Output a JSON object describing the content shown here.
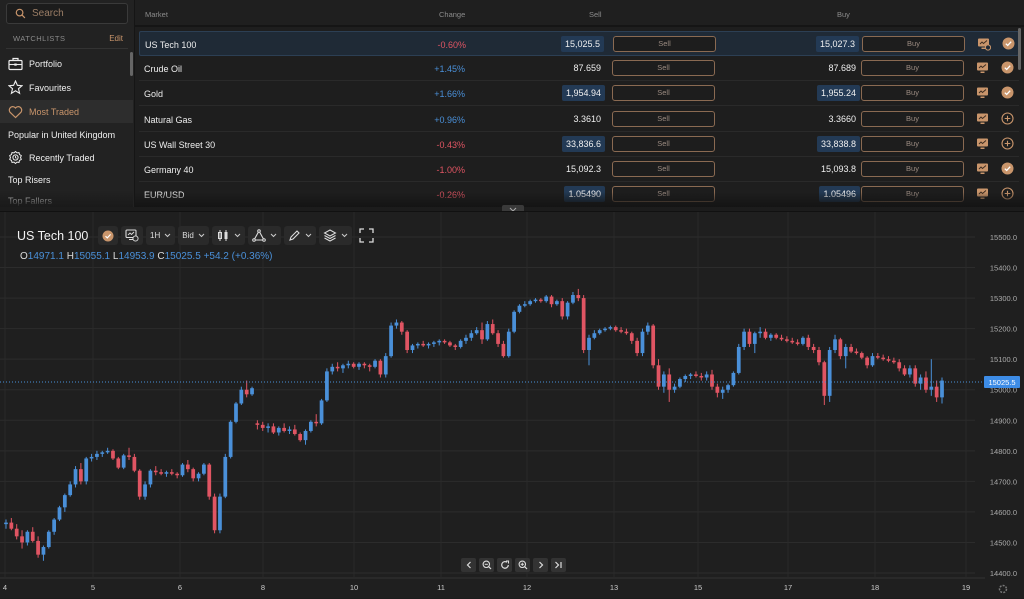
{
  "sidebar": {
    "search_placeholder": "Search",
    "watchlists_label": "WATCHLISTS",
    "edit_label": "Edit",
    "items": [
      {
        "label": "Portfolio",
        "icon": "briefcase-icon",
        "active": false
      },
      {
        "label": "Favourites",
        "icon": "star-icon",
        "active": false
      },
      {
        "label": "Most Traded",
        "icon": "heart-icon",
        "active": true
      },
      {
        "label": "Popular in United Kingdom",
        "icon": null,
        "active": false
      },
      {
        "label": "Recently Traded",
        "icon": "recent-icon",
        "active": false
      },
      {
        "label": "Top Risers",
        "icon": null,
        "active": false
      },
      {
        "label": "Top Fallers",
        "icon": null,
        "active": false
      }
    ]
  },
  "table": {
    "headers": {
      "market": "Market",
      "change": "Change",
      "sell": "Sell",
      "buy": "Buy"
    },
    "sell_label": "Sell",
    "buy_label": "Buy",
    "rows": [
      {
        "market": "US Tech 100",
        "change": "-0.60%",
        "direction": "neg",
        "sell": "15,025.5",
        "buy": "15,027.3",
        "highlight": true,
        "selected": true,
        "in_watchlist": true,
        "chart_open": true
      },
      {
        "market": "Crude Oil",
        "change": "+1.45%",
        "direction": "pos",
        "sell": "87.659",
        "buy": "87.689",
        "highlight": false,
        "selected": false,
        "in_watchlist": true,
        "chart_open": false
      },
      {
        "market": "Gold",
        "change": "+1.66%",
        "direction": "pos",
        "sell": "1,954.94",
        "buy": "1,955.24",
        "highlight": true,
        "selected": false,
        "in_watchlist": true,
        "chart_open": false
      },
      {
        "market": "Natural Gas",
        "change": "+0.96%",
        "direction": "pos",
        "sell": "3.3610",
        "buy": "3.3660",
        "highlight": false,
        "selected": false,
        "in_watchlist": false,
        "chart_open": false
      },
      {
        "market": "US Wall Street 30",
        "change": "-0.43%",
        "direction": "neg",
        "sell": "33,836.6",
        "buy": "33,838.8",
        "highlight": true,
        "selected": false,
        "in_watchlist": false,
        "chart_open": false
      },
      {
        "market": "Germany 40",
        "change": "-1.00%",
        "direction": "neg",
        "sell": "15,092.3",
        "buy": "15,093.8",
        "highlight": false,
        "selected": false,
        "in_watchlist": true,
        "chart_open": false
      },
      {
        "market": "EUR/USD",
        "change": "-0.26%",
        "direction": "neg",
        "sell": "1.05490",
        "buy": "1.05496",
        "highlight": true,
        "selected": false,
        "in_watchlist": false,
        "chart_open": false
      }
    ]
  },
  "chart_panel": {
    "title": "US Tech 100",
    "timeframe": "1H",
    "price_side": "Bid",
    "ohlc": {
      "o_label": "O",
      "o": "14971.1",
      "h_label": "H",
      "h": "15055.1",
      "l_label": "L",
      "l": "14953.9",
      "c_label": "C",
      "c": "15025.5",
      "change": "+54.2 (+0.36%)"
    },
    "current_price_label": "15025.5"
  },
  "colors": {
    "up": "#4a90d9",
    "down": "#e05563",
    "accent": "#c9956b",
    "highlight_price": "#233a55"
  },
  "chart_data": {
    "type": "candlestick",
    "title": "US Tech 100",
    "xlabel": "",
    "ylabel": "",
    "ylim": [
      14400,
      15500
    ],
    "y_ticks": [
      "15500.0",
      "15400.0",
      "15300.0",
      "15200.0",
      "15100.0",
      "15000.0",
      "14900.0",
      "14800.0",
      "14700.0",
      "14600.0",
      "14500.0",
      "14400.0"
    ],
    "x_ticks": [
      "4",
      "5",
      "6",
      "8",
      "10",
      "11",
      "12",
      "13",
      "15",
      "17",
      "18",
      "19"
    ],
    "current_price": 15025.5,
    "grid": true,
    "candles": [
      [
        14560,
        14575,
        14545,
        14565
      ],
      [
        14565,
        14580,
        14540,
        14545
      ],
      [
        14545,
        14560,
        14510,
        14520
      ],
      [
        14520,
        14540,
        14480,
        14500
      ],
      [
        14500,
        14540,
        14490,
        14535
      ],
      [
        14535,
        14550,
        14500,
        14505
      ],
      [
        14505,
        14520,
        14450,
        14460
      ],
      [
        14460,
        14490,
        14440,
        14485
      ],
      [
        14485,
        14540,
        14480,
        14535
      ],
      [
        14535,
        14580,
        14525,
        14575
      ],
      [
        14575,
        14620,
        14570,
        14615
      ],
      [
        14615,
        14660,
        14600,
        14655
      ],
      [
        14655,
        14700,
        14650,
        14690
      ],
      [
        14690,
        14750,
        14680,
        14740
      ],
      [
        14740,
        14760,
        14690,
        14700
      ],
      [
        14700,
        14780,
        14690,
        14775
      ],
      [
        14775,
        14790,
        14765,
        14780
      ],
      [
        14780,
        14800,
        14770,
        14790
      ],
      [
        14790,
        14800,
        14780,
        14795
      ],
      [
        14795,
        14810,
        14790,
        14800
      ],
      [
        14800,
        14805,
        14770,
        14775
      ],
      [
        14775,
        14780,
        14740,
        14745
      ],
      [
        14745,
        14790,
        14740,
        14785
      ],
      [
        14785,
        14810,
        14770,
        14780
      ],
      [
        14780,
        14790,
        14730,
        14735
      ],
      [
        14735,
        14740,
        14640,
        14650
      ],
      [
        14650,
        14700,
        14640,
        14690
      ],
      [
        14690,
        14740,
        14680,
        14735
      ],
      [
        14735,
        14750,
        14720,
        14730
      ],
      [
        14730,
        14740,
        14720,
        14725
      ],
      [
        14725,
        14735,
        14715,
        14730
      ],
      [
        14730,
        14740,
        14720,
        14725
      ],
      [
        14725,
        14730,
        14710,
        14720
      ],
      [
        14720,
        14760,
        14715,
        14755
      ],
      [
        14755,
        14770,
        14730,
        14740
      ],
      [
        14740,
        14745,
        14700,
        14710
      ],
      [
        14710,
        14730,
        14700,
        14725
      ],
      [
        14725,
        14760,
        14720,
        14755
      ],
      [
        14755,
        14760,
        14640,
        14650
      ],
      [
        14650,
        14660,
        14530,
        14540
      ],
      [
        14540,
        14660,
        14530,
        14650
      ],
      [
        14650,
        14790,
        14645,
        14780
      ],
      [
        14780,
        14900,
        14775,
        14895
      ],
      [
        14895,
        14960,
        14890,
        14955
      ],
      [
        14955,
        15010,
        14950,
        15000
      ],
      [
        15000,
        15030,
        14975,
        14985
      ],
      [
        14985,
        15010,
        14980,
        15005
      ],
      [
        14890,
        14900,
        14870,
        14885
      ],
      [
        14885,
        14895,
        14865,
        14875
      ],
      [
        14875,
        14890,
        14860,
        14880
      ],
      [
        14880,
        14890,
        14855,
        14860
      ],
      [
        14860,
        14880,
        14850,
        14875
      ],
      [
        14875,
        14890,
        14860,
        14865
      ],
      [
        14865,
        14880,
        14855,
        14870
      ],
      [
        14870,
        14885,
        14850,
        14855
      ],
      [
        14855,
        14860,
        14830,
        14835
      ],
      [
        14835,
        14870,
        14820,
        14865
      ],
      [
        14865,
        14900,
        14860,
        14895
      ],
      [
        14895,
        14920,
        14880,
        14890
      ],
      [
        14890,
        14970,
        14885,
        14965
      ],
      [
        14965,
        15070,
        14960,
        15060
      ],
      [
        15060,
        15085,
        15050,
        15075
      ],
      [
        15075,
        15090,
        15060,
        15070
      ],
      [
        15070,
        15085,
        15055,
        15080
      ],
      [
        15080,
        15095,
        15070,
        15085
      ],
      [
        15085,
        15090,
        15070,
        15075
      ],
      [
        15075,
        15090,
        15065,
        15085
      ],
      [
        15085,
        15090,
        15070,
        15080
      ],
      [
        15080,
        15085,
        15060,
        15075
      ],
      [
        15075,
        15100,
        15070,
        15095
      ],
      [
        15095,
        15100,
        15040,
        15050
      ],
      [
        15050,
        15120,
        15040,
        15110
      ],
      [
        15110,
        15220,
        15105,
        15210
      ],
      [
        15210,
        15230,
        15200,
        15220
      ],
      [
        15220,
        15225,
        15180,
        15190
      ],
      [
        15190,
        15195,
        15120,
        15130
      ],
      [
        15130,
        15150,
        15120,
        15145
      ],
      [
        15145,
        15155,
        15135,
        15150
      ],
      [
        15150,
        15160,
        15140,
        15145
      ],
      [
        15145,
        15155,
        15135,
        15150
      ],
      [
        15150,
        15160,
        15140,
        15155
      ],
      [
        15155,
        15165,
        15145,
        15160
      ],
      [
        15160,
        15165,
        15150,
        15155
      ],
      [
        15155,
        15160,
        15140,
        15145
      ],
      [
        15145,
        15150,
        15130,
        15140
      ],
      [
        15140,
        15165,
        15135,
        15160
      ],
      [
        15160,
        15180,
        15150,
        15170
      ],
      [
        15170,
        15195,
        15160,
        15185
      ],
      [
        15185,
        15205,
        15180,
        15195
      ],
      [
        15195,
        15220,
        15150,
        15165
      ],
      [
        15165,
        15225,
        15160,
        15215
      ],
      [
        15215,
        15230,
        15180,
        15185
      ],
      [
        15185,
        15195,
        15140,
        15150
      ],
      [
        15150,
        15160,
        15105,
        15110
      ],
      [
        15110,
        15200,
        15105,
        15190
      ],
      [
        15190,
        15260,
        15185,
        15255
      ],
      [
        15255,
        15280,
        15250,
        15275
      ],
      [
        15275,
        15290,
        15270,
        15280
      ],
      [
        15280,
        15295,
        15275,
        15290
      ],
      [
        15290,
        15300,
        15285,
        15295
      ],
      [
        15295,
        15300,
        15285,
        15290
      ],
      [
        15290,
        15310,
        15285,
        15305
      ],
      [
        15305,
        15310,
        15270,
        15280
      ],
      [
        15280,
        15295,
        15275,
        15290
      ],
      [
        15290,
        15300,
        15230,
        15240
      ],
      [
        15240,
        15290,
        15230,
        15285
      ],
      [
        15285,
        15320,
        15280,
        15310
      ],
      [
        15310,
        15330,
        15290,
        15300
      ],
      [
        15300,
        15310,
        15120,
        15130
      ],
      [
        15130,
        15180,
        15080,
        15170
      ],
      [
        15170,
        15195,
        15165,
        15185
      ],
      [
        15185,
        15200,
        15180,
        15195
      ],
      [
        15195,
        15205,
        15190,
        15200
      ],
      [
        15200,
        15210,
        15195,
        15205
      ],
      [
        15205,
        15210,
        15190,
        15195
      ],
      [
        15195,
        15205,
        15185,
        15190
      ],
      [
        15190,
        15200,
        15180,
        15185
      ],
      [
        15185,
        15190,
        15150,
        15160
      ],
      [
        15160,
        15170,
        15110,
        15120
      ],
      [
        15120,
        15200,
        15110,
        15190
      ],
      [
        15190,
        15220,
        15180,
        15210
      ],
      [
        15210,
        15215,
        15070,
        15080
      ],
      [
        15080,
        15100,
        15000,
        15010
      ],
      [
        15010,
        15060,
        14990,
        15050
      ],
      [
        15050,
        15070,
        14960,
        15000
      ],
      [
        15000,
        15020,
        14990,
        15010
      ],
      [
        15010,
        15040,
        15005,
        15035
      ],
      [
        15035,
        15050,
        15025,
        15045
      ],
      [
        15045,
        15055,
        15035,
        15050
      ],
      [
        15050,
        15060,
        15040,
        15045
      ],
      [
        15045,
        15055,
        15030,
        15040
      ],
      [
        15040,
        15060,
        15030,
        15050
      ],
      [
        15050,
        15065,
        15000,
        15010
      ],
      [
        15010,
        15020,
        14975,
        14990
      ],
      [
        14990,
        15010,
        14970,
        15000
      ],
      [
        15000,
        15020,
        14990,
        15015
      ],
      [
        15015,
        15060,
        15010,
        15055
      ],
      [
        15055,
        15150,
        15050,
        15140
      ],
      [
        15140,
        15200,
        15130,
        15190
      ],
      [
        15190,
        15200,
        15140,
        15150
      ],
      [
        15150,
        15190,
        15120,
        15185
      ],
      [
        15185,
        15205,
        15170,
        15190
      ],
      [
        15190,
        15200,
        15165,
        15170
      ],
      [
        15170,
        15185,
        15160,
        15180
      ],
      [
        15180,
        15185,
        15165,
        15170
      ],
      [
        15170,
        15180,
        15160,
        15165
      ],
      [
        15165,
        15175,
        15155,
        15160
      ],
      [
        15160,
        15170,
        15150,
        15155
      ],
      [
        15155,
        15165,
        15145,
        15150
      ],
      [
        15150,
        15175,
        15145,
        15170
      ],
      [
        15170,
        15180,
        15130,
        15140
      ],
      [
        15140,
        15150,
        15120,
        15130
      ],
      [
        15130,
        15140,
        15080,
        15090
      ],
      [
        15090,
        15095,
        14950,
        14980
      ],
      [
        14980,
        15140,
        14960,
        15130
      ],
      [
        15130,
        15180,
        15120,
        15165
      ],
      [
        15165,
        15170,
        15100,
        15110
      ],
      [
        15110,
        15150,
        15070,
        15140
      ],
      [
        15140,
        15150,
        15120,
        15125
      ],
      [
        15125,
        15135,
        15115,
        15120
      ],
      [
        15120,
        15125,
        15100,
        15105
      ],
      [
        15105,
        15110,
        15070,
        15080
      ],
      [
        15080,
        15120,
        15075,
        15110
      ],
      [
        15110,
        15120,
        15100,
        15105
      ],
      [
        15105,
        15115,
        15095,
        15100
      ],
      [
        15100,
        15110,
        15090,
        15095
      ],
      [
        15095,
        15105,
        15085,
        15090
      ],
      [
        15090,
        15100,
        15060,
        15070
      ],
      [
        15070,
        15080,
        15045,
        15050
      ],
      [
        15050,
        15080,
        15040,
        15070
      ],
      [
        15070,
        15080,
        15010,
        15020
      ],
      [
        15020,
        15050,
        15000,
        15040
      ],
      [
        15040,
        15060,
        14990,
        15000
      ],
      [
        15000,
        15100,
        14980,
        15010
      ],
      [
        15010,
        15030,
        14960,
        14975
      ],
      [
        14975,
        15040,
        14955,
        15030
      ]
    ]
  },
  "nav_buttons": [
    "scroll-left",
    "zoom-out",
    "reset",
    "zoom-in",
    "scroll-right",
    "go-to-latest"
  ]
}
